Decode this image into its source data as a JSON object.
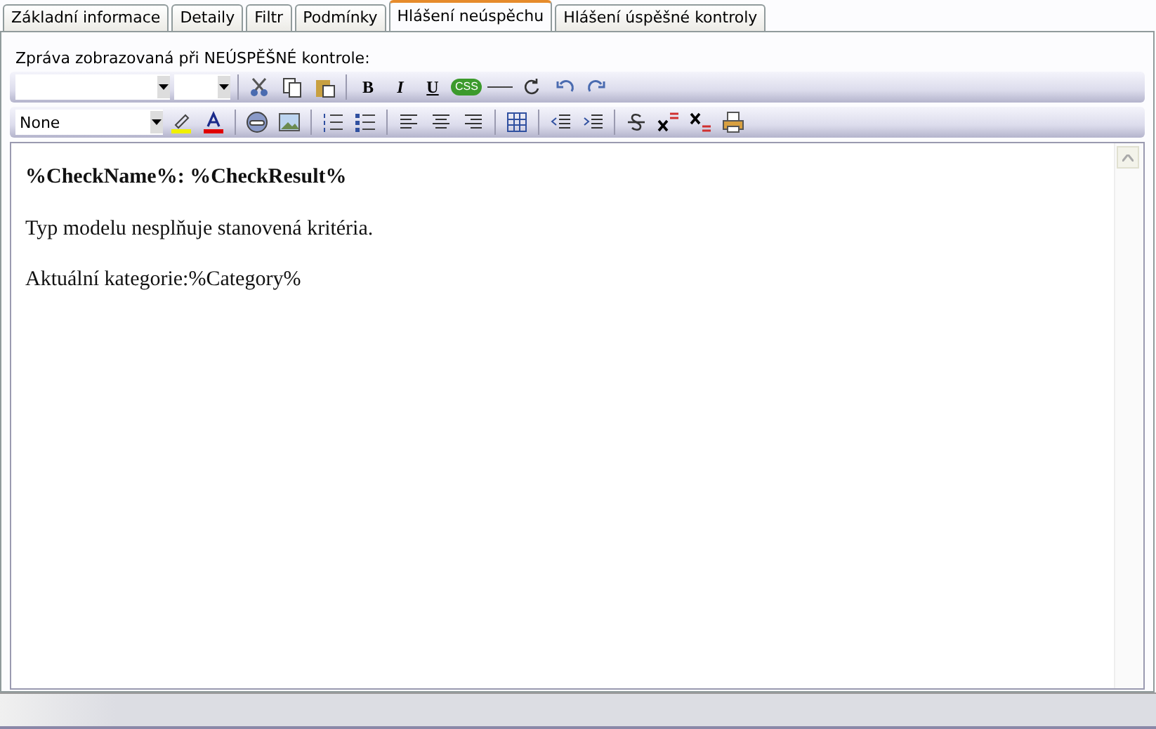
{
  "tabs": [
    {
      "label": "Základní informace",
      "selected": false
    },
    {
      "label": "Detaily",
      "selected": false
    },
    {
      "label": "Filtr",
      "selected": false
    },
    {
      "label": "Podmínky",
      "selected": false
    },
    {
      "label": "Hlášení neúspěchu",
      "selected": true
    },
    {
      "label": "Hlášení úspěšné kontroly",
      "selected": false
    }
  ],
  "caption": "Zpráva zobrazovaná při NEÚSPĚŠNÉ kontrole:",
  "toolbar1": [
    {
      "kind": "fontselect"
    },
    {
      "kind": "sizeselect"
    },
    {
      "kind": "sep"
    },
    {
      "kind": "cut"
    },
    {
      "kind": "copy"
    },
    {
      "kind": "paste"
    },
    {
      "kind": "sep"
    },
    {
      "kind": "bold",
      "label": "B"
    },
    {
      "kind": "italic",
      "label": "I"
    },
    {
      "kind": "underline",
      "label": "U"
    },
    {
      "kind": "css",
      "label": "CSS"
    },
    {
      "kind": "rule"
    },
    {
      "kind": "refresh"
    },
    {
      "kind": "undo"
    },
    {
      "kind": "redo"
    }
  ],
  "toolbar2": [
    {
      "kind": "styleselect",
      "label": "None"
    },
    {
      "kind": "highlight"
    },
    {
      "kind": "fontcolor"
    },
    {
      "kind": "sep"
    },
    {
      "kind": "link"
    },
    {
      "kind": "image"
    },
    {
      "kind": "sep"
    },
    {
      "kind": "olist"
    },
    {
      "kind": "ulist"
    },
    {
      "kind": "sep"
    },
    {
      "kind": "alignleft"
    },
    {
      "kind": "aligncenter"
    },
    {
      "kind": "alignright"
    },
    {
      "kind": "sep"
    },
    {
      "kind": "table"
    },
    {
      "kind": "sep"
    },
    {
      "kind": "outdent"
    },
    {
      "kind": "indent"
    },
    {
      "kind": "sep"
    },
    {
      "kind": "strike"
    },
    {
      "kind": "superscript"
    },
    {
      "kind": "subscript"
    },
    {
      "kind": "print"
    }
  ],
  "editor": [
    {
      "kind": "heading",
      "text": "%CheckName%: %CheckResult%"
    },
    {
      "kind": "para",
      "text": "Typ modelu nesplňuje stanovená kritéria."
    },
    {
      "kind": "para",
      "text": "Aktuální kategorie:%Category%"
    }
  ]
}
